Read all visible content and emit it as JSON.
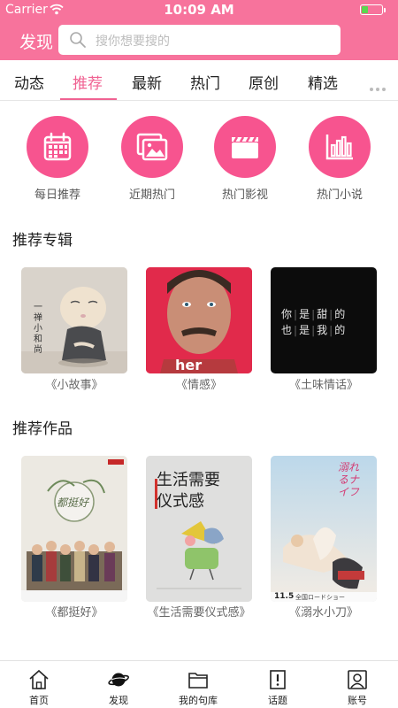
{
  "status_bar": {
    "carrier": "Carrier",
    "time": "10:09 AM",
    "battery_level": 0.3
  },
  "header": {
    "title": "发现",
    "search_placeholder": "搜你想要搜的"
  },
  "tabs": [
    {
      "label": "动态",
      "active": false
    },
    {
      "label": "推荐",
      "active": true
    },
    {
      "label": "最新",
      "active": false
    },
    {
      "label": "热门",
      "active": false
    },
    {
      "label": "原创",
      "active": false
    },
    {
      "label": "精选",
      "active": false
    }
  ],
  "quick_links": [
    {
      "label": "每日推荐",
      "icon": "calendar-icon"
    },
    {
      "label": "近期热门",
      "icon": "photos-icon"
    },
    {
      "label": "热门影视",
      "icon": "clapperboard-icon"
    },
    {
      "label": "热门小说",
      "icon": "bar-chart-icon"
    }
  ],
  "albums_section": {
    "title": "推荐专辑",
    "items": [
      {
        "label": "《小故事》",
        "cover_text": "一禅小和尚"
      },
      {
        "label": "《情感》",
        "cover_text": "her"
      },
      {
        "label": "《土味情话》",
        "cover_text": [
          "你",
          "是",
          "甜",
          "的",
          "也",
          "是",
          "我",
          "的"
        ]
      }
    ]
  },
  "works_section": {
    "title": "推荐作品",
    "items": [
      {
        "label": "《都挺好》",
        "cover_text": "都挺好"
      },
      {
        "label": "《生活需要仪式感》",
        "cover_text": "生活需要\n仪式感"
      },
      {
        "label": "《溺水小刀》",
        "cover_text": "溺れるナイフ",
        "cover_date": "11.5",
        "cover_tagline": "全国ロードショー"
      }
    ]
  },
  "bottom_nav": [
    {
      "label": "首页",
      "icon": "home-icon"
    },
    {
      "label": "发现",
      "icon": "planet-icon"
    },
    {
      "label": "我的句库",
      "icon": "folder-icon"
    },
    {
      "label": "话题",
      "icon": "topic-icon"
    },
    {
      "label": "账号",
      "icon": "account-icon"
    }
  ],
  "colors": {
    "brand": "#f7739c",
    "accent": "#f06292",
    "circle": "#f7548f"
  }
}
